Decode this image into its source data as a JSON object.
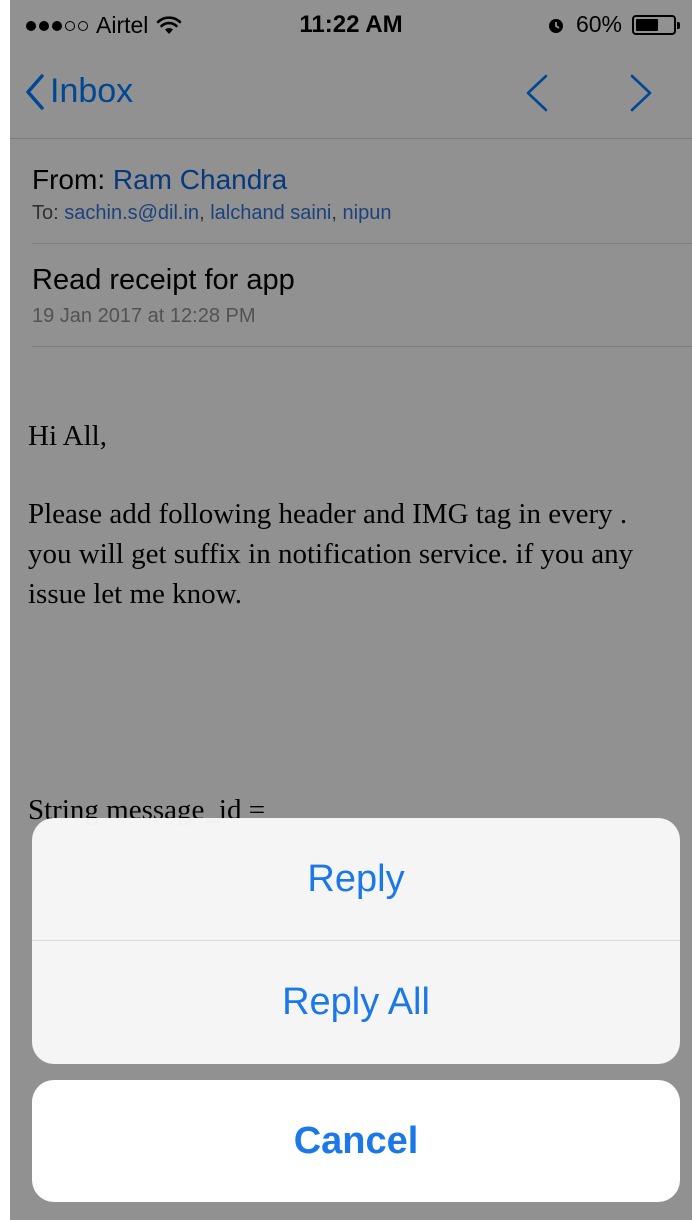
{
  "status_bar": {
    "carrier": "Airtel",
    "time": "11:22 AM",
    "battery": "60%",
    "battery_level": 0.6
  },
  "nav": {
    "back_label": "Inbox",
    "prev_icon": "chevron-up-icon",
    "next_icon": "chevron-down-icon"
  },
  "message": {
    "from_label": "From:",
    "sender": "Ram Chandra",
    "to_label": "To:",
    "recipients": [
      "sachin.s@dil.in",
      "lalchand saini",
      "nipun"
    ],
    "subject": "Read receipt for app",
    "date": "19 Jan 2017 at 12:28 PM",
    "body": {
      "greeting": "Hi All,",
      "paragraph": "Please add following header and IMG tag in every . you will  get suffix in notification service. if you any issue let me know.",
      "code_line": "String message_id ="
    }
  },
  "action_sheet": {
    "reply": "Reply",
    "reply_all": "Reply All",
    "cancel": "Cancel"
  },
  "colors": {
    "accent": "#1a78e8",
    "link": "#0e63d9"
  }
}
